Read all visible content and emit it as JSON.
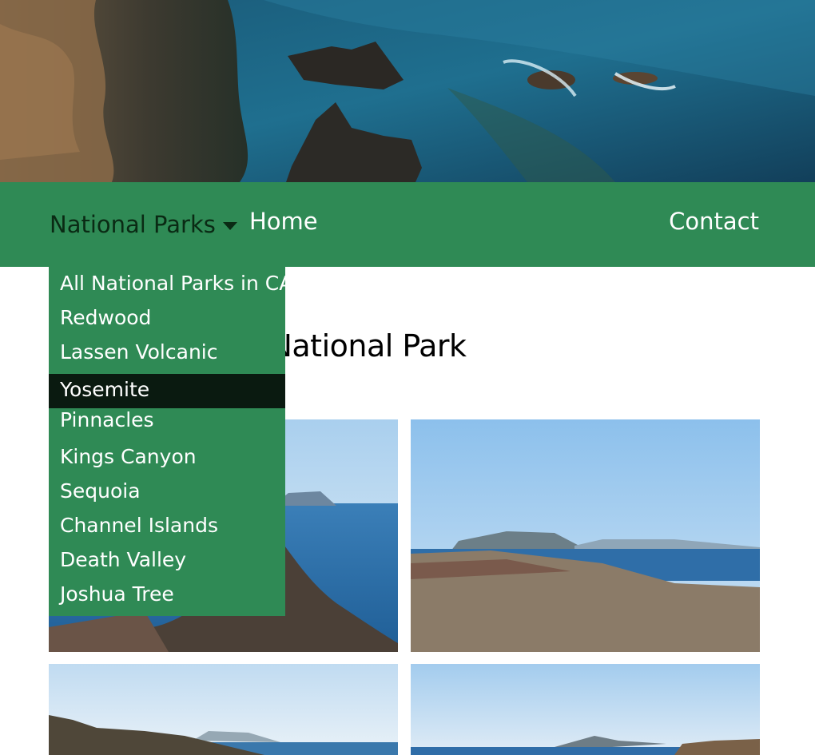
{
  "colors": {
    "nav_bg": "#2f8a55",
    "nav_text": "#ffffff",
    "nav_dropdown_toggle_text": "#0a2a14",
    "dropdown_active_bg": "#0a1a10",
    "page_bg": "#ffffff"
  },
  "nav": {
    "dropdown_label": "National Parks",
    "home_label": "Home",
    "contact_label": "Contact"
  },
  "dropdown": {
    "items": [
      "All National Parks in CA",
      "Redwood",
      "Lassen Volcanic",
      "Yosemite",
      "Pinnacles",
      "Kings Canyon",
      "Sequoia",
      "Channel Islands",
      "Death Valley",
      "Joshua Tree"
    ],
    "active_item": "Yosemite"
  },
  "main": {
    "heading_visible_part": "National Park"
  },
  "icons": {
    "dropdown_caret": "caret-down-icon"
  }
}
